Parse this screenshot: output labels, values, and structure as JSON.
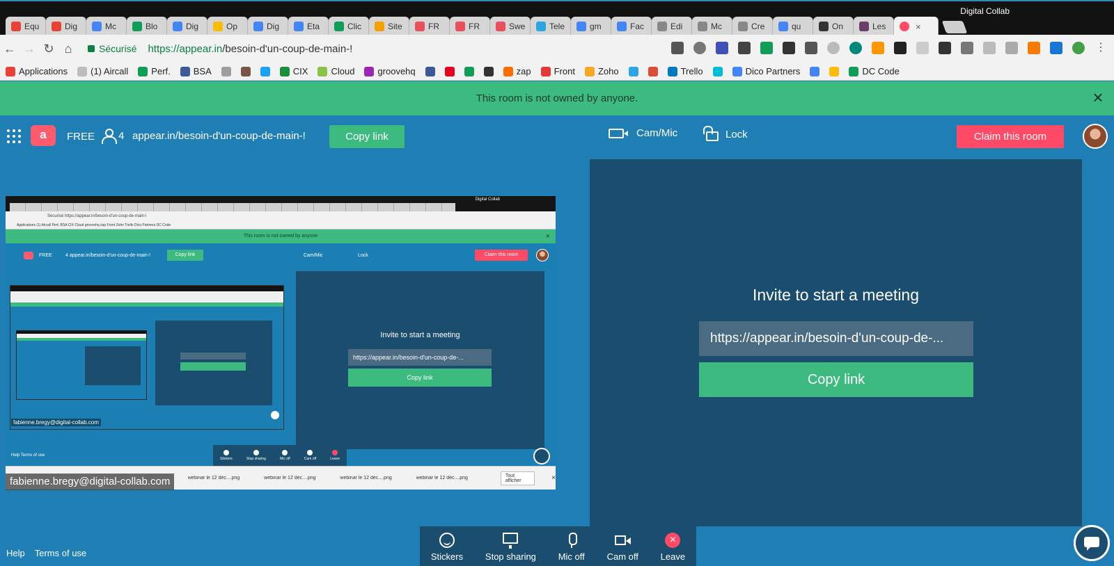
{
  "browser": {
    "profile_name": "Digital Collab",
    "tabs": [
      {
        "label": "Equ",
        "color": "#ea4335"
      },
      {
        "label": "Dig",
        "color": "#ea4335"
      },
      {
        "label": "Mc",
        "color": "#4285f4"
      },
      {
        "label": "Blo",
        "color": "#0f9d58"
      },
      {
        "label": "Dig",
        "color": "#4285f4"
      },
      {
        "label": "Op",
        "color": "#fbbc05"
      },
      {
        "label": "Dig",
        "color": "#4285f4"
      },
      {
        "label": "Eta",
        "color": "#4285f4"
      },
      {
        "label": "Clic",
        "color": "#0f9d58"
      },
      {
        "label": "Site",
        "color": "#f4a100"
      },
      {
        "label": "FR",
        "color": "#e8505b"
      },
      {
        "label": "FR",
        "color": "#e8505b"
      },
      {
        "label": "Swe",
        "color": "#e8505b"
      },
      {
        "label": "Tele",
        "color": "#2ca5e0"
      },
      {
        "label": "gm",
        "color": "#4285f4"
      },
      {
        "label": "Fac",
        "color": "#4285f4"
      },
      {
        "label": "Edi",
        "color": "#888888"
      },
      {
        "label": "Mc",
        "color": "#888888"
      },
      {
        "label": "Cre",
        "color": "#888888"
      },
      {
        "label": "qu",
        "color": "#4285f4"
      },
      {
        "label": "On",
        "color": "#333333"
      },
      {
        "label": "Les",
        "color": "#6a3d6a"
      }
    ],
    "active_tab_close": "×",
    "secure_label": "Sécurisé",
    "url_host": "https://appear.in",
    "url_path": "/besoin-d'un-coup-de-main-!",
    "bookmarks": [
      {
        "label": "Applications",
        "color": "#e94235"
      },
      {
        "label": "(1) Aircall",
        "color": "#bdbdbd"
      },
      {
        "label": "Perf.",
        "color": "#0f9d58"
      },
      {
        "label": "BSA",
        "color": "#3c5a99"
      },
      {
        "label": "",
        "color": "#9e9e9e"
      },
      {
        "label": "",
        "color": "#795548"
      },
      {
        "label": "",
        "color": "#1da1f2"
      },
      {
        "label": "CIX",
        "color": "#1b8f3a"
      },
      {
        "label": "Cloud",
        "color": "#8bc34a"
      },
      {
        "label": "groovehq",
        "color": "#9c27b0"
      },
      {
        "label": "",
        "color": "#3b5998"
      },
      {
        "label": "",
        "color": "#e60023"
      },
      {
        "label": "",
        "color": "#0f9d58"
      },
      {
        "label": "",
        "color": "#333333"
      },
      {
        "label": "zap",
        "color": "#ff6d00"
      },
      {
        "label": "Front",
        "color": "#e53935"
      },
      {
        "label": "Zoho",
        "color": "#f9a825"
      },
      {
        "label": "",
        "color": "#2ca5e0"
      },
      {
        "label": "",
        "color": "#dd4b39"
      },
      {
        "label": "Trello",
        "color": "#0079bf"
      },
      {
        "label": "",
        "color": "#00bcd4"
      },
      {
        "label": "Dico Partners",
        "color": "#4285f4"
      },
      {
        "label": "",
        "color": "#4285f4"
      },
      {
        "label": "",
        "color": "#fbbc05"
      },
      {
        "label": "DC Code",
        "color": "#0f9d58"
      }
    ]
  },
  "notice": {
    "text": "This room is not owned by anyone.",
    "close": "×"
  },
  "room": {
    "logo_letter": "a",
    "plan": "FREE",
    "participants": "4",
    "url": "appear.in/besoin-d'un-coup-de-main-!",
    "copy_link": "Copy link",
    "cam_mic": "Cam/Mic",
    "lock": "Lock",
    "claim": "Claim this room"
  },
  "shared_screen": {
    "profile_name": "Digital Collab",
    "url": "Sécurisé   https://appear.in/besoin-d'un-coup-de-main-!",
    "bookmarks": "Applications  (1) Aircall  Perf.  BSA  CIX  Cloud  groovehq  zap  Front  Zoho  Trello  Dico Partners  DC Code",
    "notice": "This room is not owned by anyone",
    "plan": "FREE",
    "room_url": "4  appear.in/besoin-d'un-coup-de-main-!",
    "copy_link": "Copy link",
    "cam_mic": "Cam/Mic",
    "lock": "Lock",
    "claim": "Claim this room",
    "invite_title": "Invite to start a meeting",
    "invite_url": "https://appear.in/besoin-d'un-coup-de-...",
    "invite_copy": "Copy link",
    "inner_email": "fabienne.bregy@digital-collab.com",
    "footer": "Help   Terms of use",
    "toolbar": [
      "Stickers",
      "Stop sharing",
      "Mic off",
      "Cam off",
      "Leave"
    ],
    "downloads": [
      "webinar le 12 déc....png",
      "webinar le 12 déc....png",
      "webinar le 12 déc....png",
      "webinar le 12 déc....png"
    ],
    "show_all": "Tout afficher",
    "downloads_close": "×"
  },
  "shared_email": "fabienne.bregy@digital-collab.com",
  "invite": {
    "title": "Invite to start a meeting",
    "url": "https://appear.in/besoin-d'un-coup-de-...",
    "copy": "Copy link"
  },
  "footer": {
    "help": "Help",
    "terms": "Terms of use"
  },
  "toolbar": {
    "stickers": "Stickers",
    "stop_sharing": "Stop sharing",
    "mic_off": "Mic off",
    "cam_off": "Cam off",
    "leave": "Leave",
    "leave_symbol": "×"
  },
  "colors": {
    "accent_green": "#3dba80",
    "claim_red": "#ff4a67",
    "panel_blue": "#1b4d6e",
    "background_blue": "#1f7fb5"
  }
}
